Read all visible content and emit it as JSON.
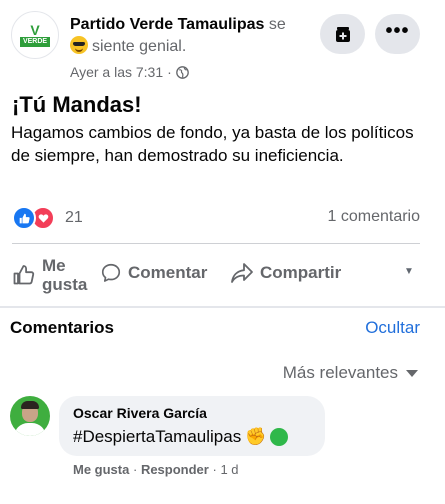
{
  "post": {
    "page_name": "Partido Verde Tamaulipas",
    "feeling_prefix": "se",
    "feeling_text": "siente genial.",
    "timestamp": "Ayer a las 7:31",
    "logo_text": "VERDE",
    "logo_letter": "V",
    "title": "¡Tú Mandas!",
    "body": "Hagamos cambios de fondo, ya basta de los políticos de siempre, han demostrado su ineficiencia."
  },
  "reactions": {
    "count": "21",
    "comments": "1 comentario"
  },
  "actions": {
    "like_line1": "Me",
    "like_line2": "gusta",
    "comment": "Comentar",
    "share": "Compartir"
  },
  "comments_section": {
    "title": "Comentarios",
    "hide": "Ocultar",
    "sort": "Más relevantes"
  },
  "comment": {
    "author": "Oscar Rivera García",
    "text": "#DespiertaTamaulipas",
    "like": "Me gusta",
    "sep1": "·",
    "reply": "Responder",
    "sep2": "·",
    "age": "1 d"
  },
  "icons": {
    "globe": "globe-icon",
    "save": "bookmark-add-icon",
    "more": "more-dots-icon",
    "like": "thumbs-up-icon",
    "comment": "comment-bubble-icon",
    "share": "share-arrow-icon"
  },
  "colors": {
    "link": "#216fdb",
    "like_blue": "#1877f2",
    "love_red": "#f33e58",
    "brand_green": "#2e9e3a"
  }
}
